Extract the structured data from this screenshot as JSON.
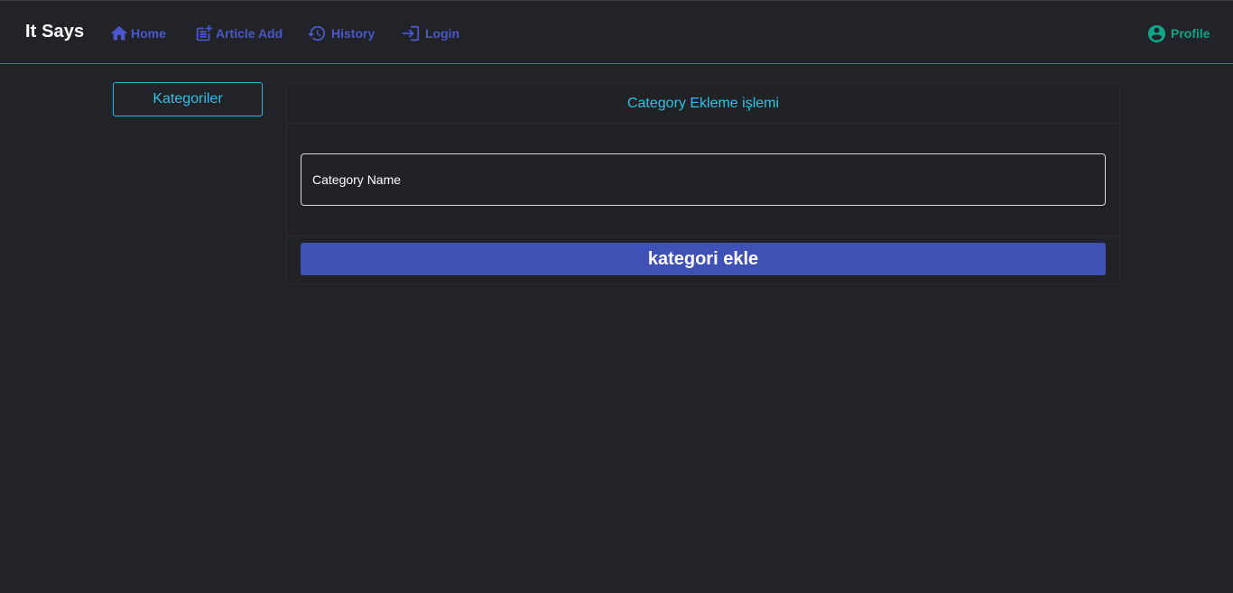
{
  "navbar": {
    "brand": "It Says",
    "links": {
      "home": "Home",
      "article_add": "Article Add",
      "history": "History",
      "login": "Login",
      "profile": "Profile"
    },
    "icons": {
      "home": "home-icon",
      "article_add": "post-add-icon",
      "history": "history-icon",
      "login": "login-icon",
      "profile": "account-circle-icon"
    }
  },
  "sidebar": {
    "categories_button": "Kategoriler"
  },
  "form": {
    "title": "Category Ekleme işlemi",
    "name_placeholder": "Category Name",
    "name_value": "",
    "submit_label": "kategori ekle"
  },
  "colors": {
    "background": "#212328",
    "nav_link": "#4a57c8",
    "profile_link": "#13a386",
    "accent_cyan": "#2dc2e3",
    "primary_button": "#3f51b5",
    "nav_border": "#2f6fd6"
  }
}
